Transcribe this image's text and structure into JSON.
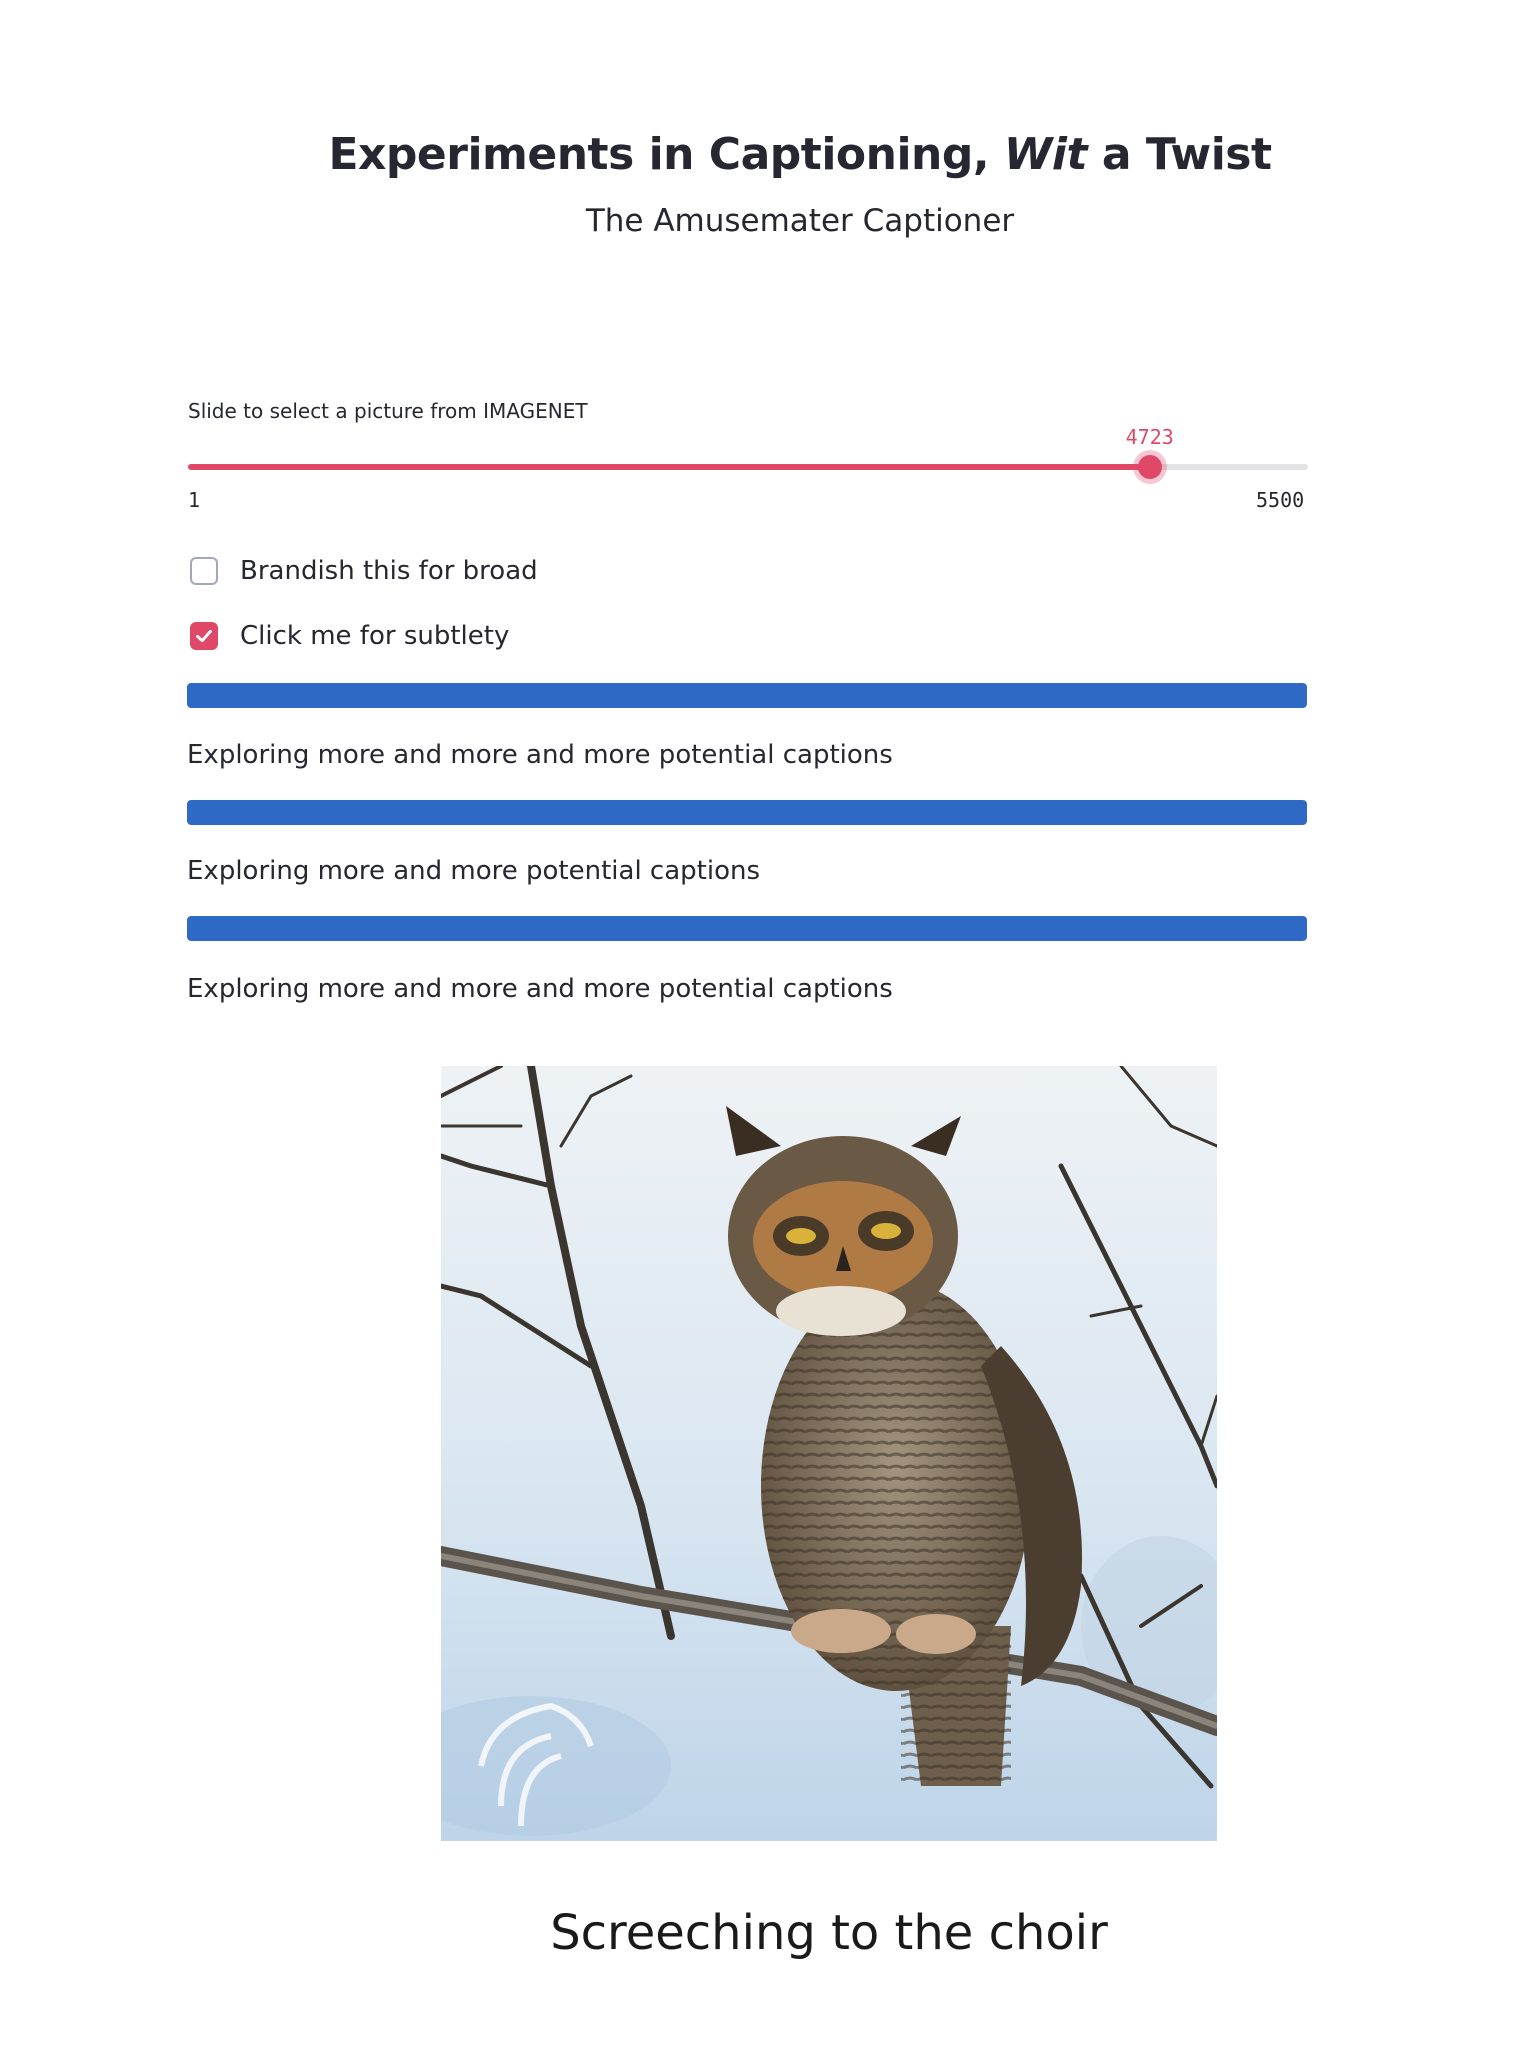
{
  "header": {
    "title_part1": "Experiments in Captioning, ",
    "title_italic": "Wit",
    "title_part2": " a Twist",
    "subtitle": "The Amusemater Captioner"
  },
  "slider": {
    "label": "Slide to select a picture from IMAGENET",
    "value": 4723,
    "min": 1,
    "max": 5500,
    "value_text": "4723",
    "min_text": "1",
    "max_text": "5500",
    "accent_color": "#e04868"
  },
  "options": [
    {
      "label": "Brandish this for broad",
      "checked": false
    },
    {
      "label": "Click me for subtlety",
      "checked": true
    }
  ],
  "progress_items": [
    {
      "progress": 1.0,
      "text": "Exploring more and more and more potential captions"
    },
    {
      "progress": 1.0,
      "text": "Exploring more and more potential captions"
    },
    {
      "progress": 1.0,
      "text": "Exploring more and more and more potential captions"
    }
  ],
  "progress_color": "#2e69c6",
  "image": {
    "subject": "great-horned-owl-on-branch",
    "caption": "Screeching to the choir"
  }
}
